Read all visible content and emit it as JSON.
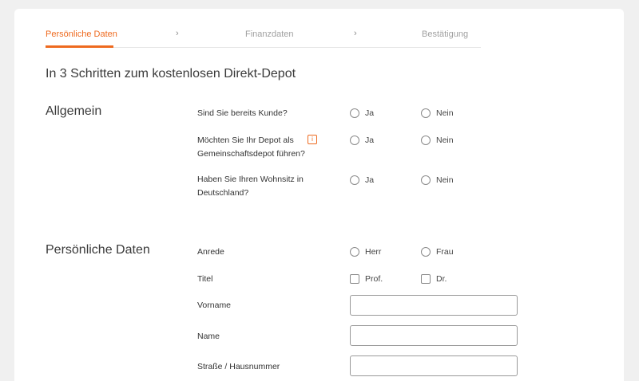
{
  "stepper": {
    "steps": [
      {
        "label": "Persönliche Daten"
      },
      {
        "label": "Finanzdaten"
      },
      {
        "label": "Bestätigung"
      }
    ],
    "separator": "›"
  },
  "headline": "In 3 Schritten zum kostenlosen Direkt-Depot",
  "sections": {
    "allgemein": {
      "title": "Allgemein",
      "questions": [
        {
          "label": "Sind Sie bereits Kunde?",
          "options": [
            "Ja",
            "Nein"
          ]
        },
        {
          "label": "Möchten Sie Ihr Depot als Gemeinschaftsdepot führen?",
          "options": [
            "Ja",
            "Nein"
          ],
          "info_icon": "i"
        },
        {
          "label": "Haben Sie Ihren Wohnsitz in Deutschland?",
          "options": [
            "Ja",
            "Nein"
          ]
        }
      ]
    },
    "persoenliche_daten": {
      "title": "Persönliche Daten",
      "anrede": {
        "label": "Anrede",
        "options": [
          "Herr",
          "Frau"
        ]
      },
      "titel": {
        "label": "Titel",
        "options": [
          "Prof.",
          "Dr."
        ]
      },
      "fields": [
        {
          "label": "Vorname",
          "value": "",
          "placeholder": ""
        },
        {
          "label": "Name",
          "value": "",
          "placeholder": ""
        },
        {
          "label": "Straße / Hausnummer",
          "value": "",
          "placeholder": ""
        }
      ]
    }
  },
  "colors": {
    "accent": "#ee6a1f",
    "background": "#f0f0f0",
    "card": "#ffffff"
  }
}
